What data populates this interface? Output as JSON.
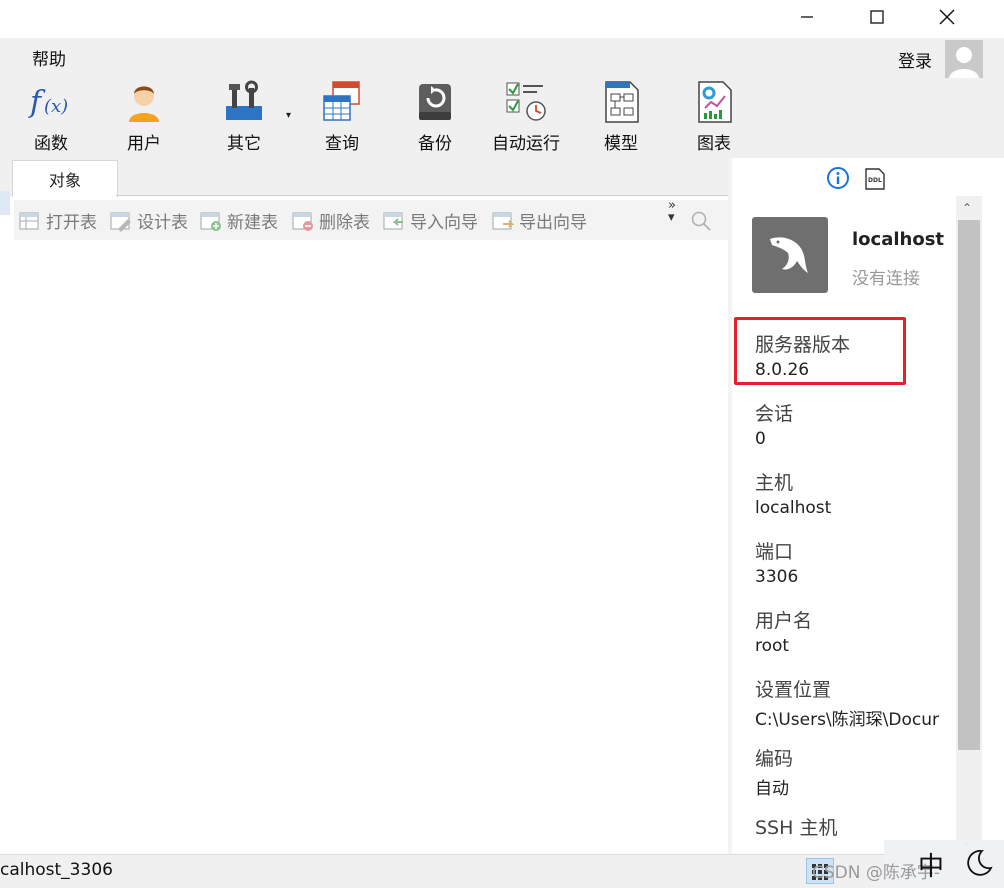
{
  "menu": {
    "help": "帮助"
  },
  "account": {
    "login": "登录"
  },
  "toolbar": {
    "items": [
      {
        "label": "函数",
        "icon": "function-icon"
      },
      {
        "label": "用户",
        "icon": "user-icon"
      },
      {
        "label": "其它",
        "icon": "tools-icon"
      },
      {
        "label": "查询",
        "icon": "query-icon"
      },
      {
        "label": "备份",
        "icon": "backup-icon"
      },
      {
        "label": "自动运行",
        "icon": "automation-icon"
      },
      {
        "label": "模型",
        "icon": "model-icon"
      },
      {
        "label": "图表",
        "icon": "chart-icon"
      }
    ]
  },
  "tabs": {
    "objects": "对象"
  },
  "object_toolbar": {
    "open_table": "打开表",
    "design_table": "设计表",
    "new_table": "新建表",
    "delete_table": "删除表",
    "import_wizard": "导入向导",
    "export_wizard": "导出向导"
  },
  "connection": {
    "name": "localhost_",
    "status": "没有连接"
  },
  "properties": [
    {
      "label": "服务器版本",
      "value": "8.0.26"
    },
    {
      "label": "会话",
      "value": "0"
    },
    {
      "label": "主机",
      "value": "localhost"
    },
    {
      "label": "端口",
      "value": "3306"
    },
    {
      "label": "用户名",
      "value": "root"
    },
    {
      "label": "设置位置",
      "value": "C:\\Users\\陈润琛\\Docur"
    },
    {
      "label": "编码",
      "value": "自动"
    },
    {
      "label": "SSH 主机",
      "value": ""
    }
  ],
  "statusbar": {
    "connection": "calhost_3306"
  },
  "ime": {
    "mode": "中"
  },
  "watermark": "CSDN @陈承宇-",
  "colors": {
    "highlight": "#e5202a",
    "info_blue": "#1a73d9",
    "pane_bg": "#f0f0f0"
  }
}
